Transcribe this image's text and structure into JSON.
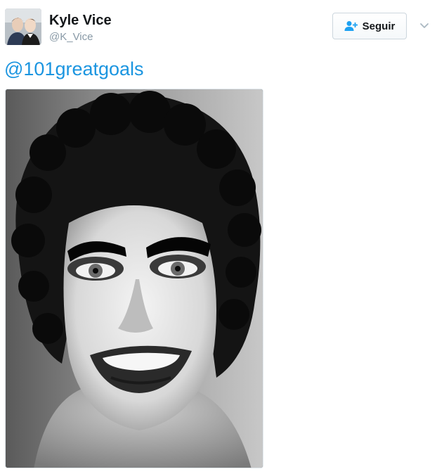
{
  "author": {
    "name": "Kyle Vice",
    "handle": "@K_Vice",
    "avatar_icon": "profile-photo"
  },
  "follow_button": {
    "label": "Seguir",
    "icon": "add-user-icon",
    "icon_color": "#1da1f2"
  },
  "menu": {
    "icon": "chevron-down-icon"
  },
  "tweet": {
    "text": "@101greatgoals",
    "link_color": "#1b95e0"
  },
  "media": {
    "type": "photo",
    "style": "black-and-white portrait"
  }
}
